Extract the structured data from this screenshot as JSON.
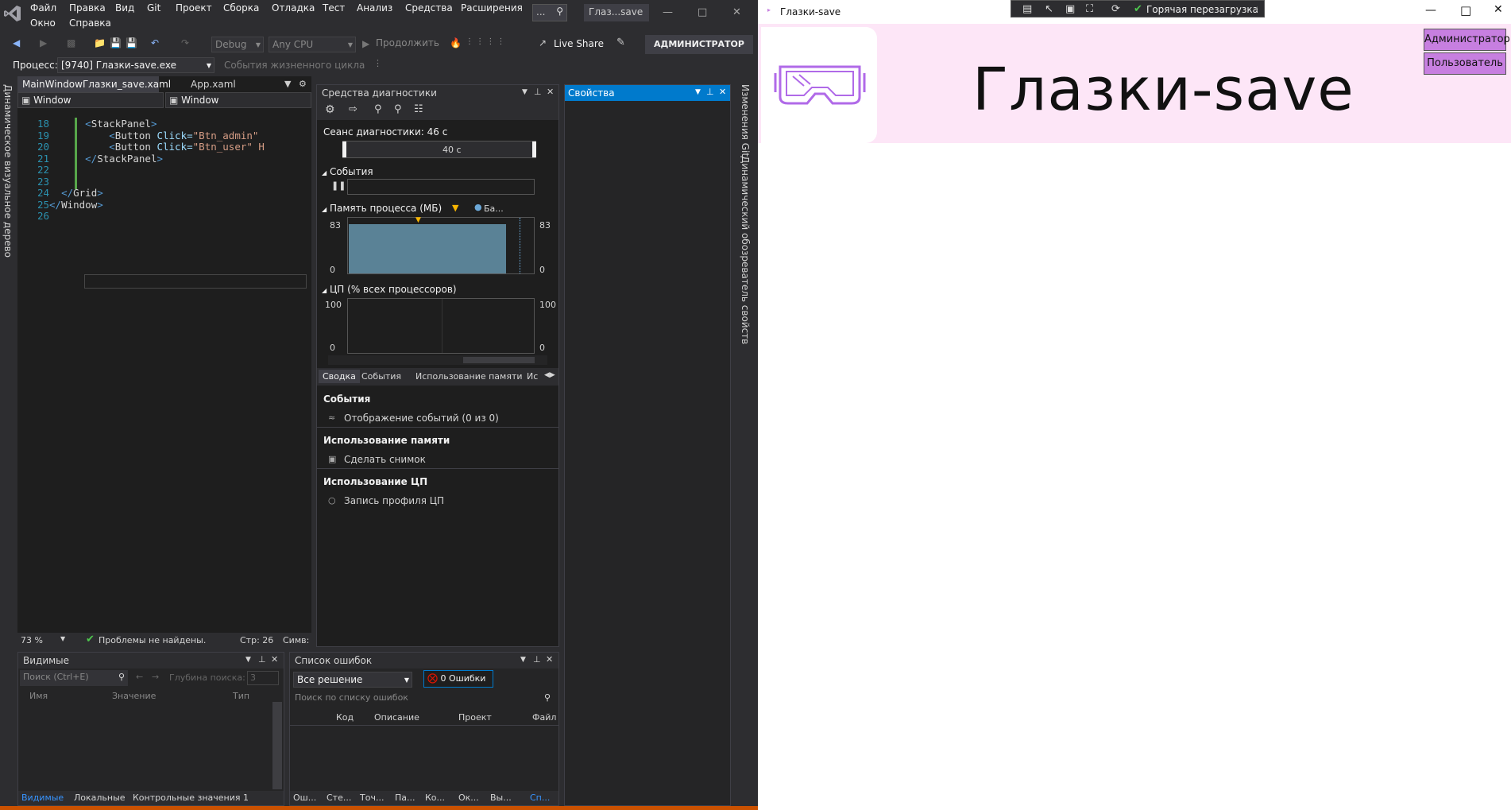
{
  "vs": {
    "menu": [
      "Файл",
      "Правка",
      "Вид",
      "Git",
      "Проект",
      "Сборка",
      "Отладка",
      "Тест",
      "Анализ",
      "Средства",
      "Расширения",
      "Окно",
      "Справка"
    ],
    "search_placeholder": "...",
    "window_title": "Глаз...save",
    "toolbar": {
      "config": "Debug",
      "platform": "Any CPU",
      "continue_label": "Продолжить",
      "live_share": "Live Share",
      "admin_badge": "АДМИНИСТРАТОР"
    },
    "process": {
      "label": "Процесс:",
      "value": "[9740] Глазки-save.exe",
      "lifecycle_events": "События жизненного цикла"
    },
    "left_strip_text": "Динамическое визуальное дерево",
    "right_strip_text_1": "Изменения Git",
    "right_strip_text_2": "Динамический обозреватель свойств",
    "editor": {
      "tabs": [
        "MainWindowГлазки_save.xaml",
        "App.xaml"
      ],
      "scope_left": "Window",
      "scope_right": "Window",
      "lines": [
        {
          "n": "18",
          "indent": "      ",
          "tag_open": "<",
          "tag": "StackPanel",
          "rest": ">",
          "attr": "",
          "val": ""
        },
        {
          "n": "19",
          "indent": "          ",
          "tag_open": "<",
          "tag": "Button",
          "rest": "",
          "attr": " Click=",
          "val": "\"Btn_admin\""
        },
        {
          "n": "20",
          "indent": "          ",
          "tag_open": "<",
          "tag": "Button",
          "rest": "",
          "attr": " Click=",
          "val": "\"Btn_user\" H"
        },
        {
          "n": "21",
          "indent": "      ",
          "tag_open": "</",
          "tag": "StackPanel",
          "rest": ">",
          "attr": "",
          "val": ""
        },
        {
          "n": "22",
          "indent": "",
          "tag_open": "",
          "tag": "",
          "rest": "",
          "attr": "",
          "val": ""
        },
        {
          "n": "23",
          "indent": "",
          "tag_open": "",
          "tag": "",
          "rest": "",
          "attr": "",
          "val": ""
        },
        {
          "n": "24",
          "indent": "  ",
          "tag_open": "</",
          "tag": "Grid",
          "rest": ">",
          "attr": "",
          "val": ""
        },
        {
          "n": "25",
          "indent": "",
          "tag_open": "</",
          "tag": "Window",
          "rest": ">",
          "attr": "",
          "val": ""
        },
        {
          "n": "26",
          "indent": "",
          "tag_open": "",
          "tag": "",
          "rest": "",
          "attr": "",
          "val": ""
        }
      ],
      "zoom": "73 %",
      "status_ok": "Проблемы не найдены.",
      "line_pos": "Стр: 26",
      "char_pos": "Симв:"
    },
    "diag": {
      "title": "Средства диагностики",
      "session": "Сеанс диагностики: 46 с",
      "timeline_label": "40 с",
      "events_section": "События",
      "memory_section": "Память процесса (МБ)",
      "memory_legend": "Ба...",
      "mem_max": "83",
      "mem_min": "0",
      "cpu_section": "ЦП (% всех процессоров)",
      "cpu_max": "100",
      "cpu_min": "0",
      "tabs": [
        "Сводка",
        "События",
        "Использование памяти",
        "Ис"
      ],
      "summary": [
        {
          "header": "События",
          "item": "Отображение событий (0 из 0)"
        },
        {
          "header": "Использование памяти",
          "item": "Сделать снимок"
        },
        {
          "header": "Использование ЦП",
          "item": "Запись профиля ЦП"
        }
      ]
    },
    "props_title": "Свойства",
    "locals": {
      "title": "Видимые",
      "search_placeholder": "Поиск (Ctrl+E)",
      "depth_label": "Глубина поиска:",
      "depth_value": "3",
      "columns": [
        "Имя",
        "Значение",
        "Тип"
      ],
      "tabs": [
        "Видимые",
        "Локальные",
        "Контрольные значения 1"
      ]
    },
    "errors": {
      "title": "Список ошибок",
      "scope": "Все решение",
      "error_count": "0 Ошибки",
      "search_placeholder": "Поиск по списку ошибок",
      "columns": [
        "Код",
        "Описание",
        "Проект",
        "Файл"
      ],
      "tabs": [
        "Ош...",
        "Сте...",
        "Точ...",
        "Па...",
        "Ко...",
        "Ок...",
        "Вы...",
        "Сп..."
      ]
    }
  },
  "app": {
    "window_title": "Глазки-save",
    "hot_reload": "Горячая перезагрузка",
    "heading": "Глазки-save",
    "btn_admin": "Администратор",
    "btn_user": "Пользователь"
  },
  "colors": {
    "vs_bg": "#2d2d30",
    "editor_bg": "#1e1e1e",
    "accent_blue": "#007acc",
    "app_header": "#fde6f7",
    "app_button": "#c77fe0",
    "logo_purple": "#b06ae8"
  }
}
